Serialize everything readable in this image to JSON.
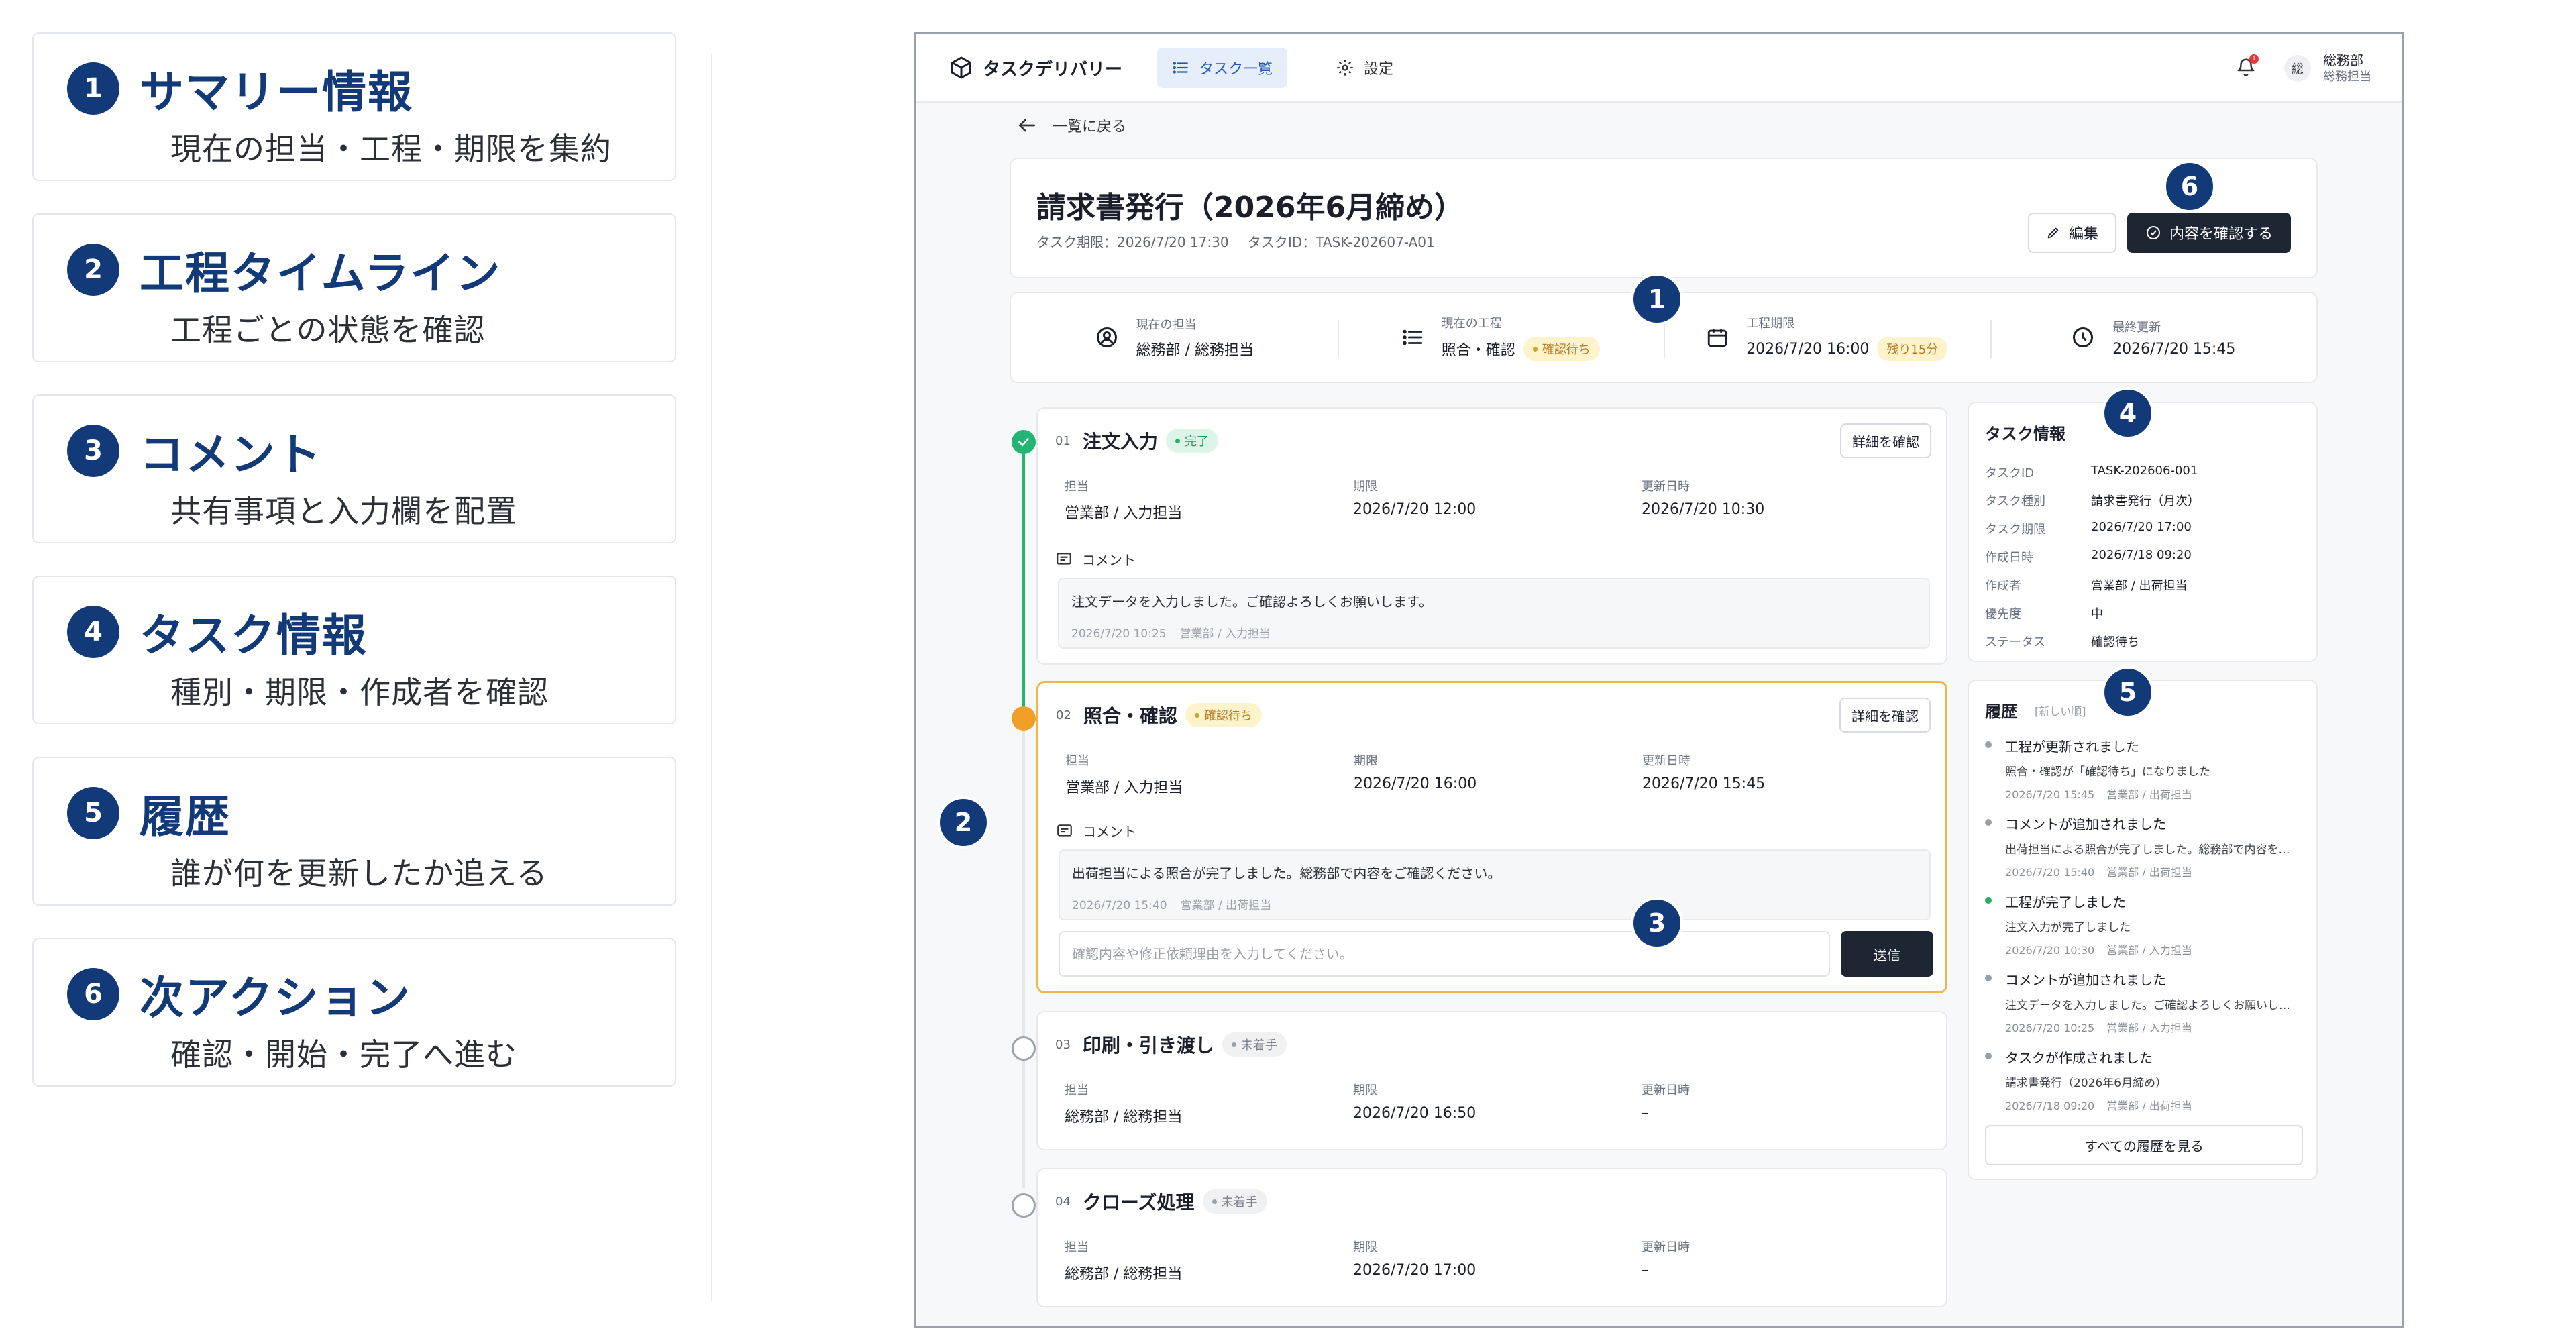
{
  "legend": [
    {
      "num": "1",
      "title": "サマリー情報",
      "desc": "現在の担当・工程・期限を集約"
    },
    {
      "num": "2",
      "title": "工程タイムライン",
      "desc": "工程ごとの状態を確認"
    },
    {
      "num": "3",
      "title": "コメント",
      "desc": "共有事項と入力欄を配置"
    },
    {
      "num": "4",
      "title": "タスク情報",
      "desc": "種別・期限・作成者を確認"
    },
    {
      "num": "5",
      "title": "履歴",
      "desc": "誰が何を更新したか追える"
    },
    {
      "num": "6",
      "title": "次アクション",
      "desc": "確認・開始・完了へ進む"
    }
  ],
  "topbar": {
    "brand": "タスクデリバリー",
    "nav_tasks": "タスク一覧",
    "nav_settings": "設定",
    "notification_count": "1",
    "avatar_initial": "総",
    "user_name": "総務部",
    "user_dept": "総務担当"
  },
  "back_label": "一覧に戻る",
  "header": {
    "title": "請求書発行（2026年6月締め）",
    "deadline": "タスク期限：2026/7/20 17:30",
    "task_id": "タスクID：TASK-202607-A01",
    "edit_label": "編集",
    "confirm_label": "内容を確認する"
  },
  "summary": [
    {
      "label": "現在の担当",
      "value": "総務部 / 総務担当",
      "badge": "",
      "icon": "user-circle-icon"
    },
    {
      "label": "現在の工程",
      "value": "照合・確認",
      "badge": "確認待ち",
      "icon": "list-icon"
    },
    {
      "label": "工程期限",
      "value": "2026/7/20 16:00",
      "badge": "残り15分",
      "icon": "calendar-icon"
    },
    {
      "label": "最終更新",
      "value": "2026/7/20 15:45",
      "badge": "",
      "icon": "clock-icon"
    }
  ],
  "steps": [
    {
      "no": "01",
      "title": "注文入力",
      "status": "完了",
      "detail": "詳細を確認",
      "assignee_label": "担当",
      "assignee": "営業部 / 入力担当",
      "deadline_label": "期限",
      "deadline": "2026/7/20 12:00",
      "updated_label": "更新日時",
      "updated": "2026/7/20 10:30",
      "comment_label": "コメント",
      "comment": "注文データを入力しました。ご確認よろしくお願いします。",
      "comment_time": "2026/7/20 10:25",
      "comment_author": "営業部 / 入力担当"
    },
    {
      "no": "02",
      "title": "照合・確認",
      "status": "確認待ち",
      "detail": "詳細を確認",
      "assignee_label": "担当",
      "assignee": "営業部 / 入力担当",
      "deadline_label": "期限",
      "deadline": "2026/7/20 16:00",
      "updated_label": "更新日時",
      "updated": "2026/7/20 15:45",
      "comment_label": "コメント",
      "comment": "出荷担当による照合が完了しました。総務部で内容をご確認ください。",
      "comment_time": "2026/7/20 15:40",
      "comment_author": "営業部 / 出荷担当",
      "input_placeholder": "確認内容や修正依頼理由を入力してください。",
      "send_label": "送信"
    },
    {
      "no": "03",
      "title": "印刷・引き渡し",
      "status": "未着手",
      "assignee_label": "担当",
      "assignee": "総務部 / 総務担当",
      "deadline_label": "期限",
      "deadline": "2026/7/20 16:50",
      "updated_label": "更新日時",
      "updated": "–"
    },
    {
      "no": "04",
      "title": "クローズ処理",
      "status": "未着手",
      "assignee_label": "担当",
      "assignee": "総務部 / 総務担当",
      "deadline_label": "期限",
      "deadline": "2026/7/20 17:00",
      "updated_label": "更新日時",
      "updated": "–"
    }
  ],
  "task_info": {
    "title": "タスク情報",
    "rows": [
      {
        "k": "タスクID",
        "v": "TASK-202606-001"
      },
      {
        "k": "タスク種別",
        "v": "請求書発行（月次）"
      },
      {
        "k": "タスク期限",
        "v": "2026/7/20 17:00"
      },
      {
        "k": "作成日時",
        "v": "2026/7/18 09:20"
      },
      {
        "k": "作成者",
        "v": "営業部 / 出荷担当"
      },
      {
        "k": "優先度",
        "v": "中"
      },
      {
        "k": "ステータス",
        "v": "確認待ち"
      }
    ]
  },
  "history": {
    "title": "履歴",
    "subtitle": "[新しい順]",
    "items": [
      {
        "title": "工程が更新されました",
        "desc": "照合・確認が「確認待ち」になりました",
        "time": "2026/7/20 15:45",
        "author": "営業部 / 出荷担当",
        "color": "gray"
      },
      {
        "title": "コメントが追加されました",
        "desc": "出荷担当による照合が完了しました。総務部で内容をご確認ください。",
        "time": "2026/7/20 15:40",
        "author": "営業部 / 出荷担当",
        "color": "gray"
      },
      {
        "title": "工程が完了しました",
        "desc": "注文入力が完了しました",
        "time": "2026/7/20 10:30",
        "author": "営業部 / 入力担当",
        "color": "green"
      },
      {
        "title": "コメントが追加されました",
        "desc": "注文データを入力しました。ご確認よろしくお願いします。",
        "time": "2026/7/20 10:25",
        "author": "営業部 / 入力担当",
        "color": "gray"
      },
      {
        "title": "タスクが作成されました",
        "desc": "請求書発行（2026年6月締め）",
        "time": "2026/7/18 09:20",
        "author": "営業部 / 出荷担当",
        "color": "gray"
      }
    ],
    "all_label": "すべての履歴を見る"
  },
  "markers": [
    "1",
    "2",
    "3",
    "4",
    "5",
    "6"
  ],
  "colors": {
    "accent": "#123a78",
    "primary_button": "#1e2633",
    "done": "#22b573",
    "current": "#f0a028"
  }
}
